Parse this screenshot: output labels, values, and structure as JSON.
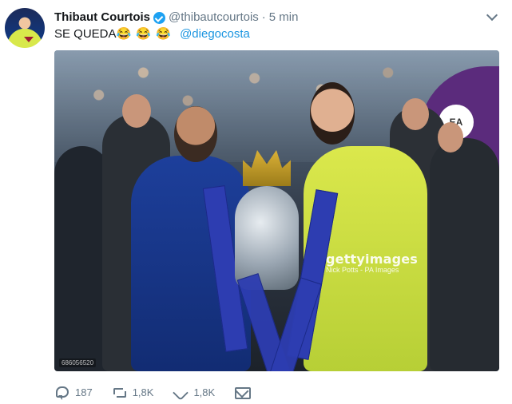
{
  "tweet": {
    "author_name": "Thibaut Courtois",
    "handle": "@thibautcourtois",
    "separator": "·",
    "time": "5 min",
    "text_main": "SE QUEDA",
    "emojis": "😂 😂 😂",
    "mention": "@diegocosta"
  },
  "media": {
    "watermark": "gettyimages",
    "credit": "Nick Potts - PA Images",
    "banner_logo": "EA",
    "photo_id": "686056520"
  },
  "actions": {
    "reply_count": "187",
    "retweet_count": "1,8K",
    "like_count": "1,8K"
  }
}
